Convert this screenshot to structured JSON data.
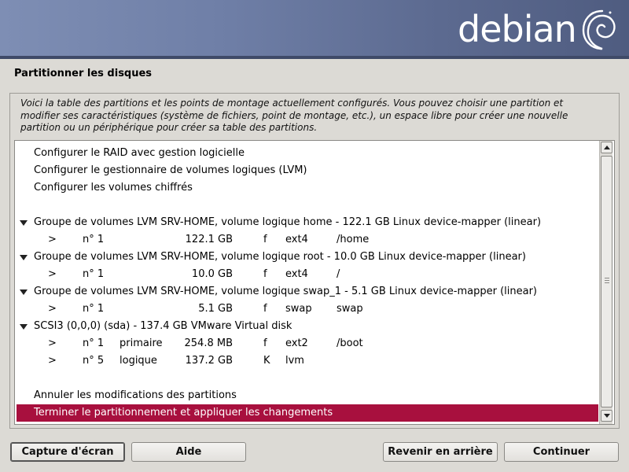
{
  "banner": {
    "logo_text": "debian"
  },
  "page": {
    "title": "Partitionner les disques"
  },
  "description": "Voici la table des partitions et les points de montage actuellement configurés. Vous pouvez choisir une partition et modifier ses caractéristiques (système de fichiers, point de montage, etc.), un espace libre pour créer une nouvelle partition ou un périphérique pour créer sa table des partitions.",
  "menu": {
    "raid": "Configurer le RAID avec gestion logicielle",
    "lvm": "Configurer le gestionnaire de volumes logiques (LVM)",
    "crypto": "Configurer les volumes chiffrés"
  },
  "groups": [
    {
      "header": "Groupe de volumes LVM SRV-HOME, volume logique home - 122.1 GB Linux device-mapper (linear)",
      "partitions": [
        {
          "arrow": ">",
          "num": "n° 1",
          "type": "",
          "size": "122.1 GB",
          "flag": "f",
          "fs": "ext4",
          "mount": "/home"
        }
      ]
    },
    {
      "header": "Groupe de volumes LVM SRV-HOME, volume logique root - 10.0 GB Linux device-mapper (linear)",
      "partitions": [
        {
          "arrow": ">",
          "num": "n° 1",
          "type": "",
          "size": "10.0 GB",
          "flag": "f",
          "fs": "ext4",
          "mount": "/"
        }
      ]
    },
    {
      "header": "Groupe de volumes LVM SRV-HOME, volume logique swap_1 - 5.1 GB Linux device-mapper (linear)",
      "partitions": [
        {
          "arrow": ">",
          "num": "n° 1",
          "type": "",
          "size": "5.1 GB",
          "flag": "f",
          "fs": "swap",
          "mount": "swap"
        }
      ]
    },
    {
      "header": "SCSI3 (0,0,0) (sda) - 137.4 GB VMware Virtual disk",
      "partitions": [
        {
          "arrow": ">",
          "num": "n° 1",
          "type": "primaire",
          "size": "254.8 MB",
          "flag": "f",
          "fs": "ext2",
          "mount": "/boot"
        },
        {
          "arrow": ">",
          "num": "n° 5",
          "type": "logique",
          "size": "137.2 GB",
          "flag": "K",
          "fs": "lvm",
          "mount": ""
        }
      ]
    }
  ],
  "actions": {
    "undo": "Annuler les modifications des partitions",
    "finish": "Terminer le partitionnement et appliquer les changements"
  },
  "buttons": {
    "screenshot": "Capture d'écran",
    "help": "Aide",
    "back": "Revenir en arrière",
    "continue": "Continuer"
  },
  "colors": {
    "selection": "#a8103e",
    "logo_swirl": "#c70036"
  }
}
